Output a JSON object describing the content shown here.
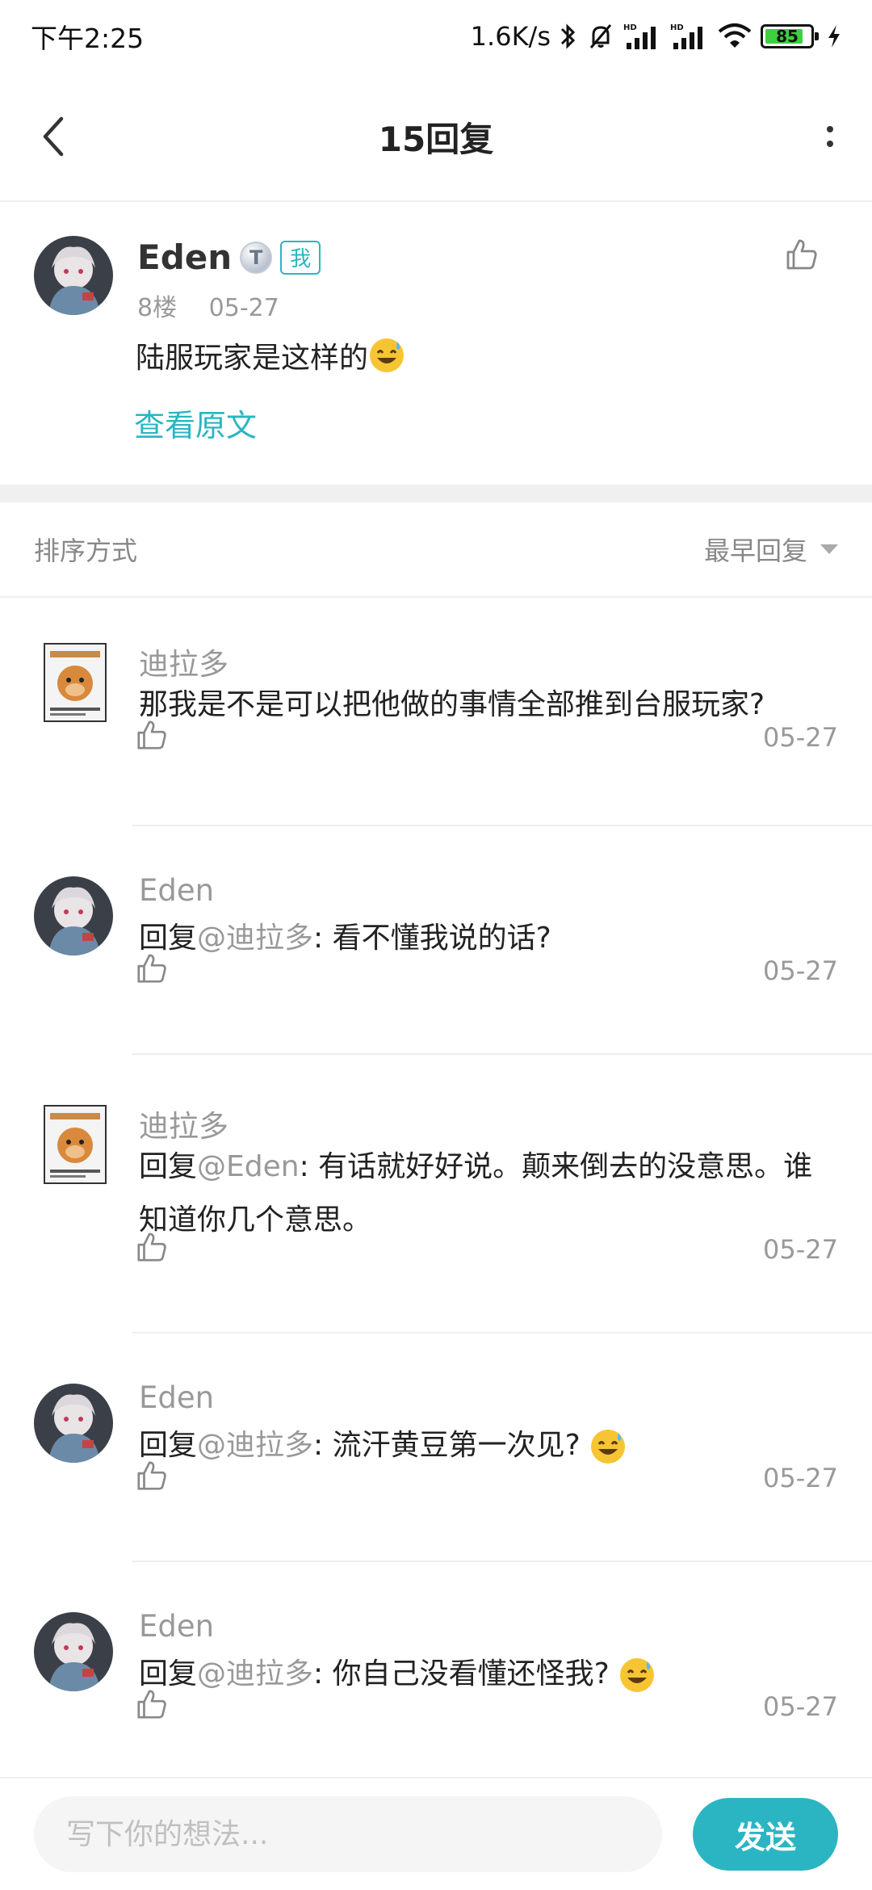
{
  "status_bar": {
    "time": "下午2:25",
    "net_speed": "1.6K/s",
    "battery": "85",
    "battery_level": 0.85
  },
  "header": {
    "title": "15回复"
  },
  "post": {
    "author": "Eden",
    "level_badge": "T",
    "me_tag": "我",
    "floor": "8楼",
    "date": "05-27",
    "content": "陆服玩家是这样的",
    "view_original": "查看原文"
  },
  "sort": {
    "label": "排序方式",
    "selected": "最早回复"
  },
  "replies": [
    {
      "author": "迪拉多",
      "prefix": "",
      "mention": "",
      "text": "那我是不是可以把他做的事情全部推到台服玩家?",
      "date": "05-27",
      "avatar": "dog"
    },
    {
      "author": "Eden",
      "prefix": "回复",
      "mention": "@迪拉多",
      "text": ": 看不懂我说的话?",
      "date": "05-27",
      "avatar": "girl"
    },
    {
      "author": "迪拉多",
      "prefix": "回复",
      "mention": "@Eden",
      "text": ": 有话就好好说。颠来倒去的没意思。谁知道你几个意思。",
      "date": "05-27",
      "avatar": "dog"
    },
    {
      "author": "Eden",
      "prefix": "回复",
      "mention": "@迪拉多",
      "text": ": 流汗黄豆第一次见?",
      "date": "05-27",
      "avatar": "girl"
    },
    {
      "author": "Eden",
      "prefix": "回复",
      "mention": "@迪拉多",
      "text": ": 你自己没看懂还怪我?",
      "date": "05-27",
      "avatar": "girl"
    }
  ],
  "input": {
    "placeholder": "写下你的想法...",
    "send_label": "发送"
  },
  "colors": {
    "accent": "#2bb5c2",
    "muted": "#999999"
  }
}
